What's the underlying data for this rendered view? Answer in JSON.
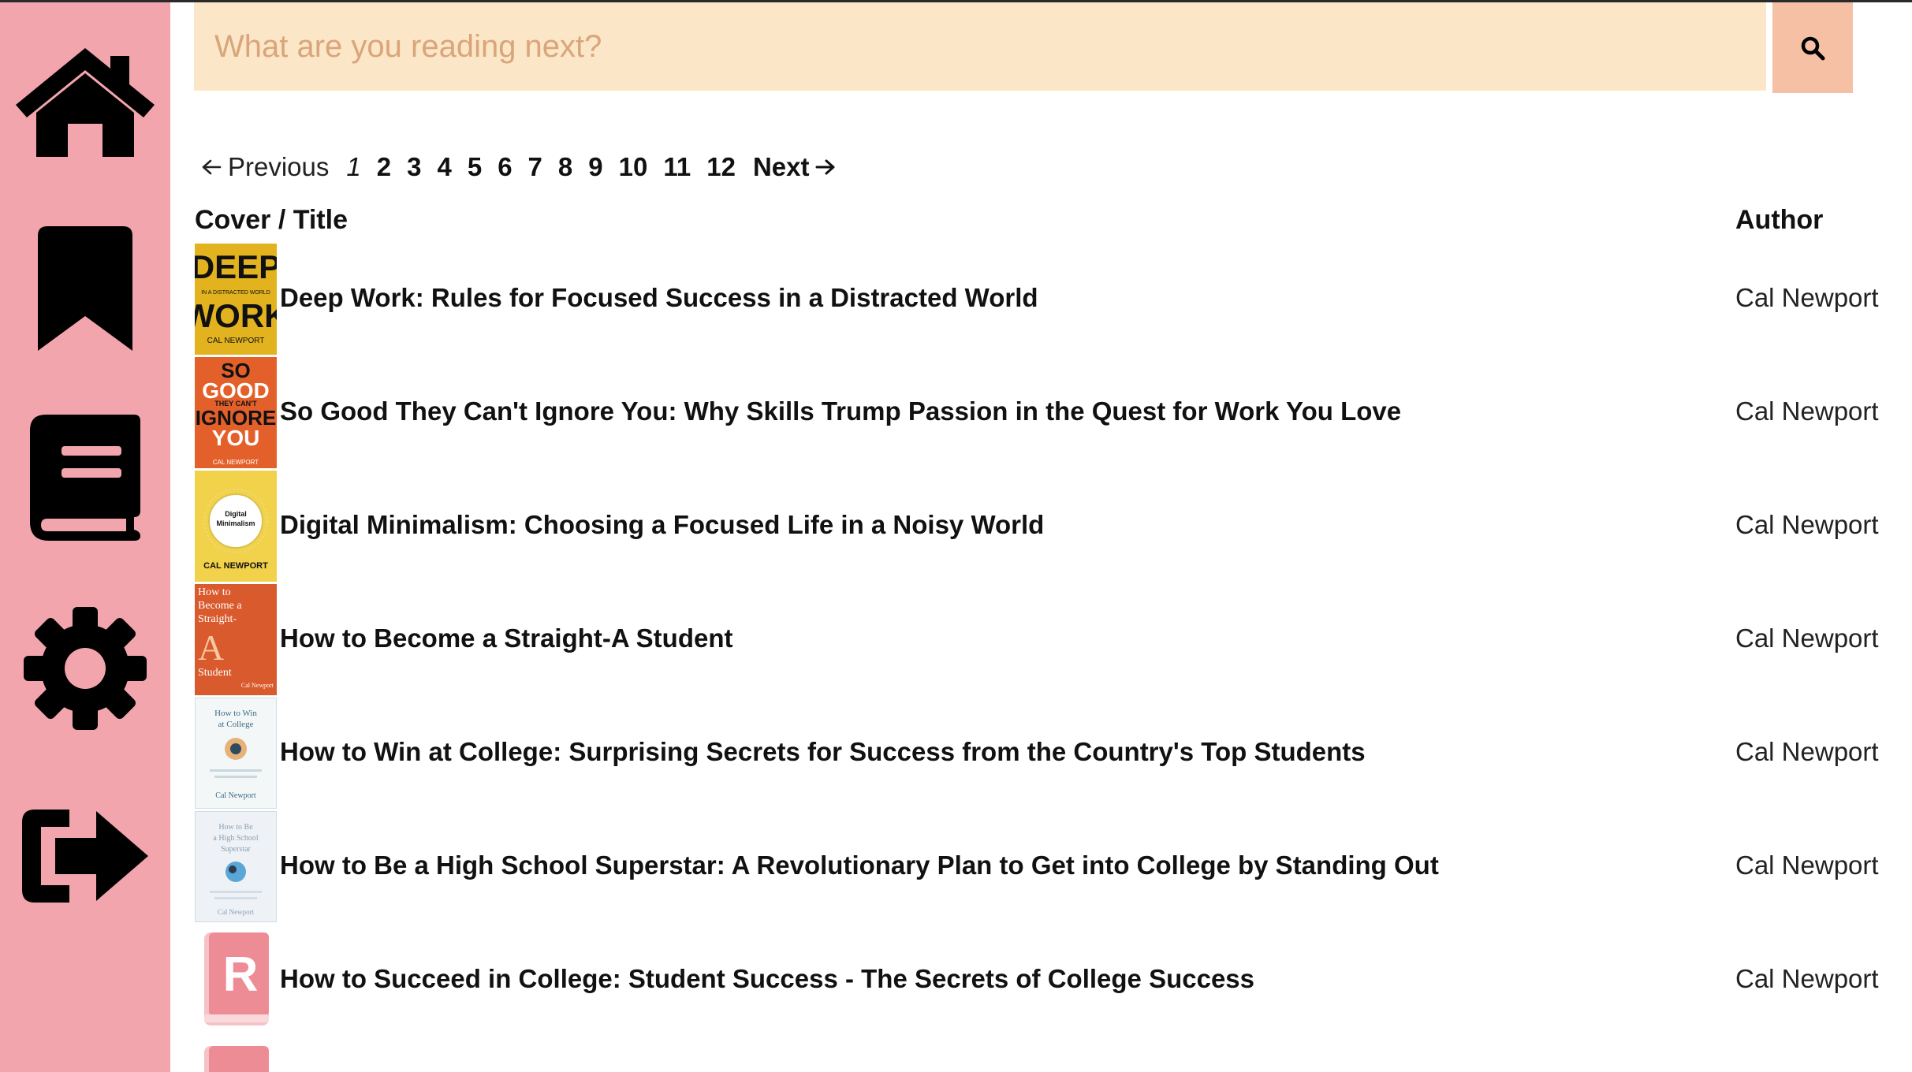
{
  "sidebar": {
    "items": [
      {
        "name": "home",
        "icon": "home-icon"
      },
      {
        "name": "bookmarks",
        "icon": "bookmark-icon"
      },
      {
        "name": "library",
        "icon": "book-icon"
      },
      {
        "name": "settings",
        "icon": "gear-icon"
      },
      {
        "name": "logout",
        "icon": "sign-out-icon"
      }
    ],
    "color": "#f3a5ad"
  },
  "search": {
    "placeholder": "What are you reading next?",
    "value": "",
    "button_icon": "search-icon",
    "field_color": "#fbe6c7",
    "button_color": "#f5c0a4"
  },
  "pagination": {
    "previous_label": "Previous",
    "next_label": "Next",
    "pages": [
      "1",
      "2",
      "3",
      "4",
      "5",
      "6",
      "7",
      "8",
      "9",
      "10",
      "11",
      "12"
    ],
    "current_page": "1"
  },
  "table": {
    "headers": {
      "title": "Cover / Title",
      "author": "Author"
    },
    "rows": [
      {
        "title": "Deep Work: Rules for Focused Success in a Distracted World",
        "author": "Cal Newport",
        "cover": {
          "lines": [
            "DEEP",
            "IN A DISTRACTED WORLD",
            "WORK",
            "CAL NEWPORT"
          ],
          "color": "#e3b21f"
        }
      },
      {
        "title": "So Good They Can't Ignore You: Why Skills Trump Passion in the Quest for Work You Love",
        "author": "Cal Newport",
        "cover": {
          "lines": [
            "SO",
            "GOOD",
            "THEY CAN'T",
            "IGNORE",
            "YOU",
            "CAL NEWPORT"
          ],
          "color": "#e4602a"
        }
      },
      {
        "title": "Digital Minimalism: Choosing a Focused Life in a Noisy World",
        "author": "Cal Newport",
        "cover": {
          "lines": [
            "Digital",
            "Minimalism",
            "CAL NEWPORT"
          ],
          "color": "#f2d24a"
        }
      },
      {
        "title": "How to Become a Straight-A Student",
        "author": "Cal Newport",
        "cover": {
          "lines": [
            "How to",
            "Become a",
            "Straight-",
            "A",
            "Student",
            "Cal Newport"
          ],
          "color": "#d95a2c"
        }
      },
      {
        "title": "How to Win at College: Surprising Secrets for Success from the Country's Top Students",
        "author": "Cal Newport",
        "cover": {
          "lines": [
            "How to Win",
            "at College",
            "Cal Newport"
          ],
          "color": "#f4f7f7"
        }
      },
      {
        "title": "How to Be a High School Superstar: A Revolutionary Plan to Get into College by Standing Out",
        "author": "Cal Newport",
        "cover": {
          "lines": [
            "How to Be",
            "a High School",
            "Superstar",
            "Cal Newport"
          ],
          "color": "#eef2f6"
        }
      },
      {
        "title": "How to Succeed in College: Student Success - The Secrets of College Success",
        "author": "Cal Newport",
        "cover": {
          "lines": [
            "R"
          ],
          "color": "#f3a5ad"
        }
      }
    ]
  }
}
